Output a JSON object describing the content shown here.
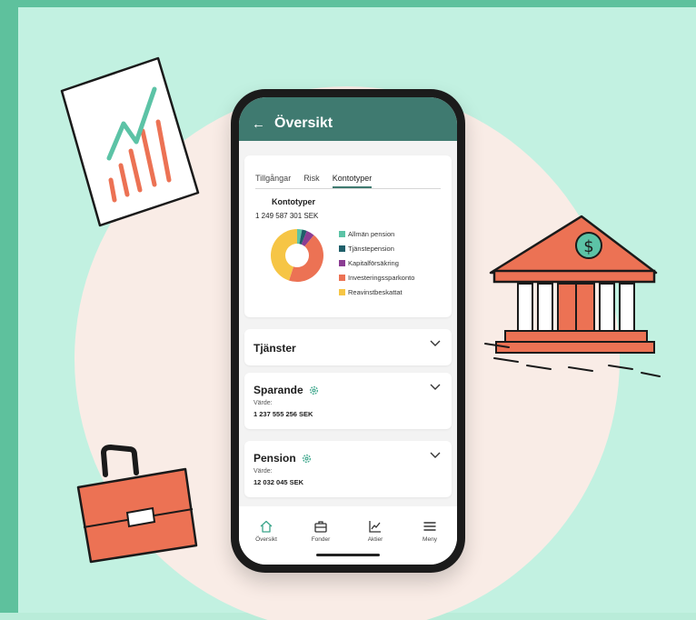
{
  "header": {
    "title": "Översikt"
  },
  "tabs": [
    {
      "label": "Tillgångar"
    },
    {
      "label": "Risk"
    },
    {
      "label": "Kontotyper"
    }
  ],
  "overview": {
    "title": "Kontotyper",
    "total": "1 249 587 301 SEK",
    "legend": [
      {
        "label": "Allmän pension",
        "color": "#5cc3a6"
      },
      {
        "label": "Tjänstepension",
        "color": "#1f5f6a"
      },
      {
        "label": "Kapitalförsäkring",
        "color": "#8b3d93"
      },
      {
        "label": "Investeringssparkonto",
        "color": "#ec7254"
      },
      {
        "label": "Reavinstbeskattat",
        "color": "#f6c545"
      }
    ]
  },
  "sections": {
    "tjanster": {
      "title": "Tjänster"
    },
    "sparande": {
      "title": "Sparande",
      "value_label": "Värde:",
      "value": "1 237 555 256 SEK"
    },
    "pension": {
      "title": "Pension",
      "value_label": "Värde:",
      "value": "12 032 045 SEK"
    }
  },
  "nav": [
    {
      "label": "Översikt",
      "icon": "home-icon"
    },
    {
      "label": "Fonder",
      "icon": "briefcase-icon"
    },
    {
      "label": "Aktier",
      "icon": "chart-icon"
    },
    {
      "label": "Meny",
      "icon": "menu-icon"
    }
  ],
  "colors": {
    "accent": "#3f7a70",
    "background": "#c2f1e1",
    "coral": "#ec7254"
  }
}
